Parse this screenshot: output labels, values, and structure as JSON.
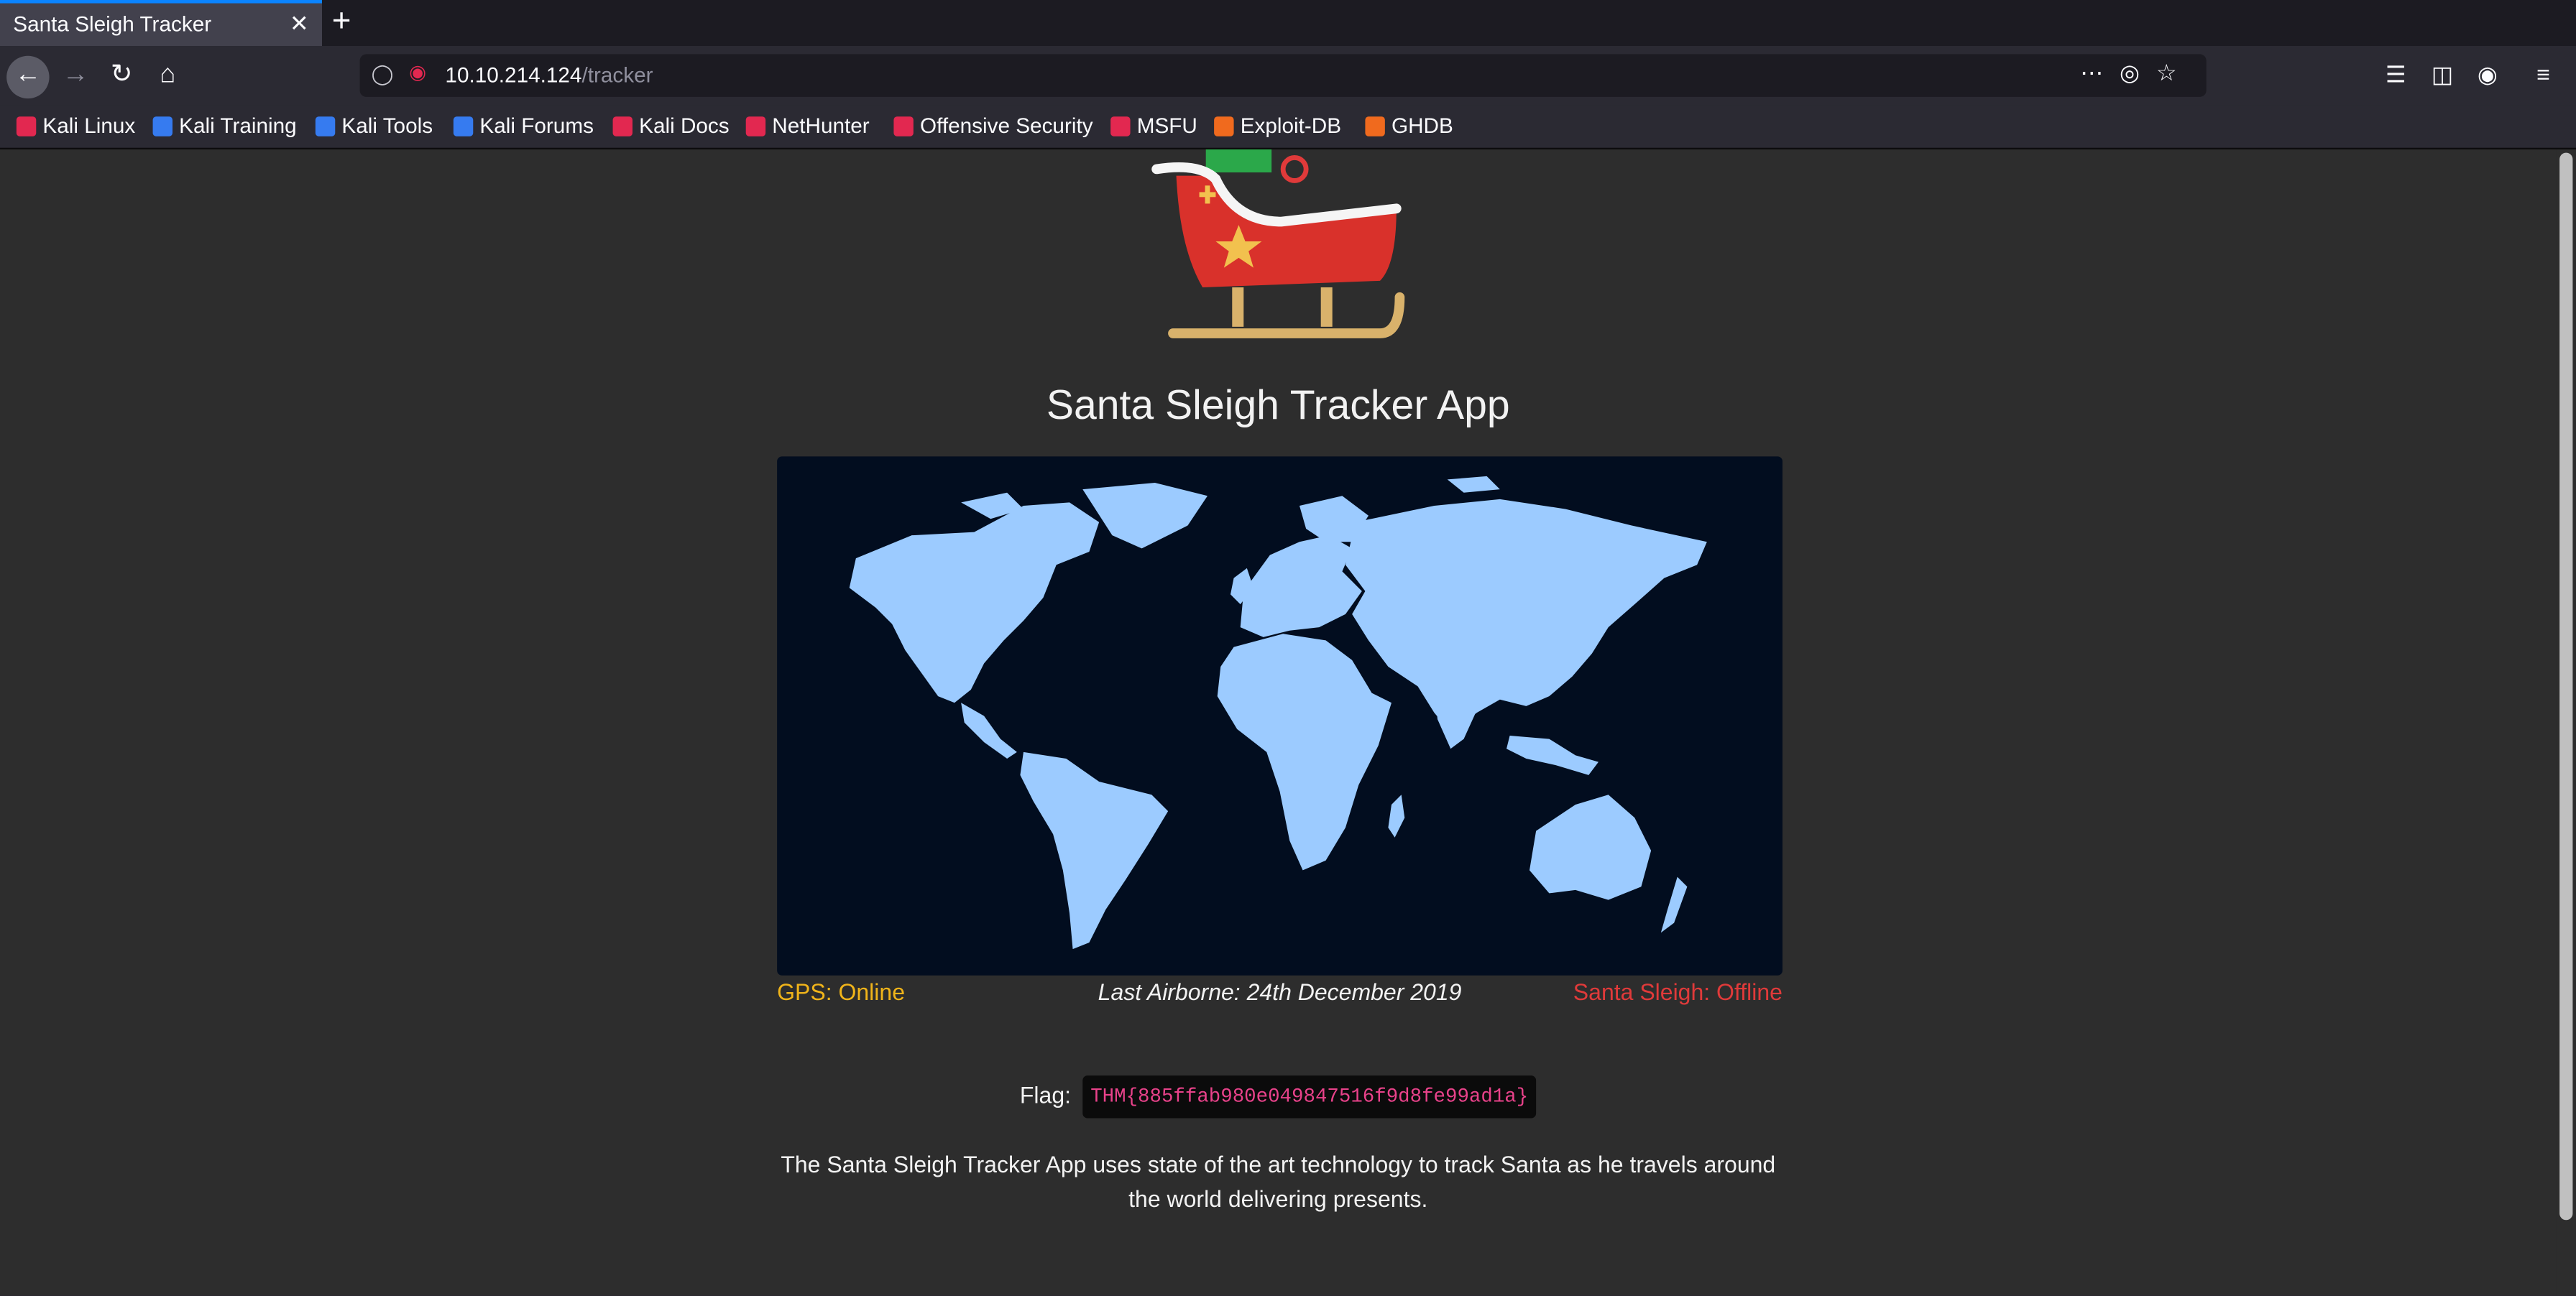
{
  "browser": {
    "tab_title": "Santa Sleigh Tracker",
    "tab_close": "✕",
    "new_tab": "+",
    "url_host": "10.10.214.124",
    "url_path": "/tracker",
    "bookmarks": [
      {
        "label": "Kali Linux",
        "icon_color": "#e22850"
      },
      {
        "label": "Kali Training",
        "icon_color": "#367bf0"
      },
      {
        "label": "Kali Tools",
        "icon_color": "#367bf0"
      },
      {
        "label": "Kali Forums",
        "icon_color": "#367bf0"
      },
      {
        "label": "Kali Docs",
        "icon_color": "#e22850"
      },
      {
        "label": "NetHunter",
        "icon_color": "#e22850"
      },
      {
        "label": "Offensive Security",
        "icon_color": "#e22850"
      },
      {
        "label": "MSFU",
        "icon_color": "#e22850"
      },
      {
        "label": "Exploit-DB",
        "icon_color": "#f06a1e"
      },
      {
        "label": "GHDB",
        "icon_color": "#f06a1e"
      }
    ]
  },
  "page": {
    "title": "Santa Sleigh Tracker App",
    "gps_status": "GPS: Online",
    "last_airborne": "Last Airborne: 24th December 2019",
    "sleigh_status": "Santa Sleigh: Offline",
    "flag_label": "Flag:",
    "flag_value": "THM{885ffab980e049847516f9d8fe99ad1a}",
    "description": "The Santa Sleigh Tracker App uses state of the art technology to track Santa as he travels around the world delivering presents.",
    "colors": {
      "gps": "#f0b41a",
      "offline": "#e03a3a",
      "map_land": "#9ccbff",
      "map_sea": "#020d1f"
    }
  }
}
